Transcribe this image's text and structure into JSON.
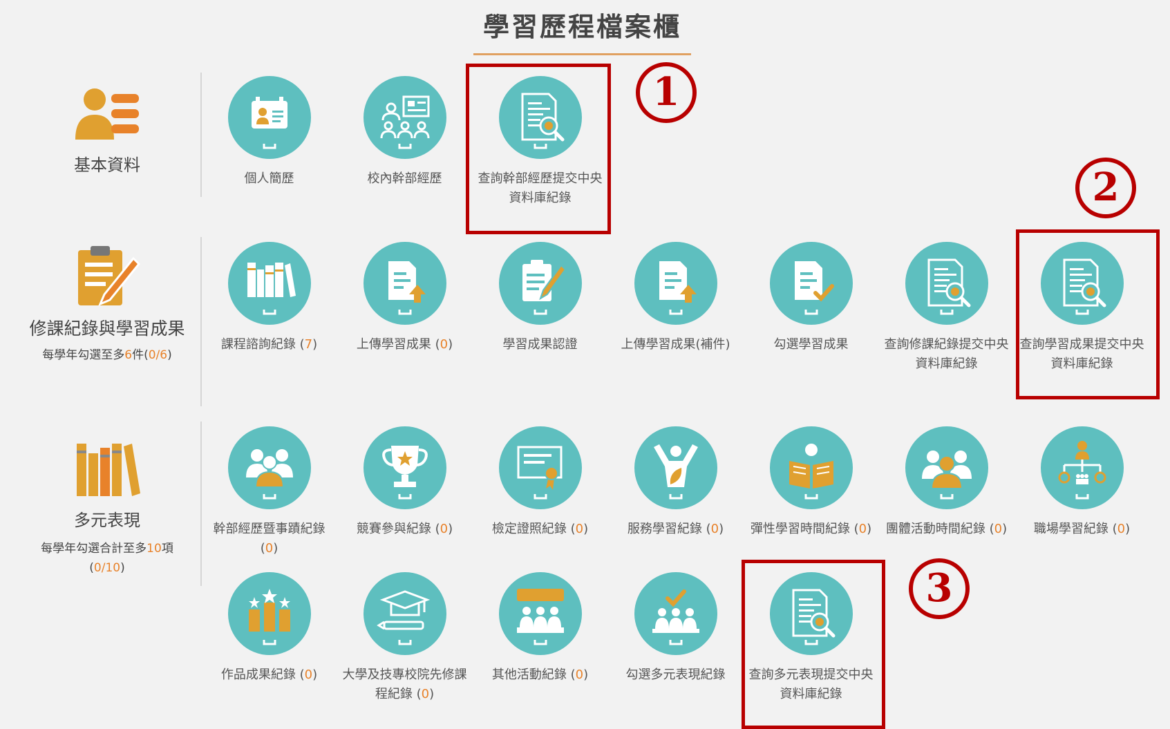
{
  "title": "學習歷程檔案櫃",
  "categories": [
    {
      "label": "基本資料",
      "icon": "profile-card-icon"
    },
    {
      "label": "修課紀錄與學習成果",
      "icon": "clipboard-pen-icon",
      "note_prefix": "每學年勾選至多",
      "note_limit": "6",
      "note_mid": "件(",
      "note_count": "0/6",
      "note_suffix": ")"
    },
    {
      "label": "多元表現",
      "icon": "books-icon",
      "note_prefix": "每學年勾選合計至多",
      "note_limit": "10",
      "note_mid": "項",
      "note_count": "0/10"
    }
  ],
  "rows": [
    [
      {
        "label": "個人簡歷",
        "icon": "id-badge-icon"
      },
      {
        "label": "校內幹部經歷",
        "icon": "group-board-icon"
      },
      {
        "label": "查詢幹部經歷提交中央資料庫紀錄",
        "icon": "document-search-icon"
      }
    ],
    [
      {
        "label": "課程諮詢紀錄",
        "count": "7",
        "icon": "books-icon"
      },
      {
        "label": "上傳學習成果",
        "count": "0",
        "icon": "file-upload-icon"
      },
      {
        "label": "學習成果認證",
        "icon": "clipboard-pen-icon"
      },
      {
        "label": "上傳學習成果(補件)",
        "icon": "file-upload-icon"
      },
      {
        "label": "勾選學習成果",
        "icon": "file-check-icon"
      },
      {
        "label": "查詢修課紀錄提交中央資料庫紀錄",
        "icon": "document-search-icon"
      },
      {
        "label": "查詢學習成果提交中央資料庫紀錄",
        "icon": "document-search-icon"
      }
    ],
    [
      {
        "label": "幹部經歷暨事蹟紀錄",
        "count": "0",
        "icon": "group-leader-icon"
      },
      {
        "label": "競賽參與紀錄",
        "count": "0",
        "icon": "trophy-icon"
      },
      {
        "label": "檢定證照紀錄",
        "count": "0",
        "icon": "certificate-icon"
      },
      {
        "label": "服務學習紀錄",
        "count": "0",
        "icon": "raised-arms-icon"
      },
      {
        "label": "彈性學習時間紀錄",
        "count": "0",
        "icon": "reader-icon"
      },
      {
        "label": "團體活動時間紀錄",
        "count": "0",
        "icon": "team-icon"
      },
      {
        "label": "職場學習紀錄",
        "count": "0",
        "icon": "org-chart-icon"
      }
    ],
    [
      {
        "label": "作品成果紀錄",
        "count": "0",
        "icon": "star-bars-icon"
      },
      {
        "label": "大學及技專校院先修課程紀錄",
        "count": "0",
        "icon": "graduation-cap-icon"
      },
      {
        "label": "其他活動紀錄",
        "count": "0",
        "icon": "audience-icon"
      },
      {
        "label": "勾選多元表現紀錄",
        "icon": "audience-check-icon"
      },
      {
        "label": "查詢多元表現提交中央資料庫紀錄",
        "icon": "document-search-icon"
      }
    ]
  ],
  "badges": [
    "1",
    "2",
    "3"
  ],
  "colors": {
    "teal": "#5ebfbf",
    "accent": "#e8822a",
    "highlight": "#b80000"
  }
}
